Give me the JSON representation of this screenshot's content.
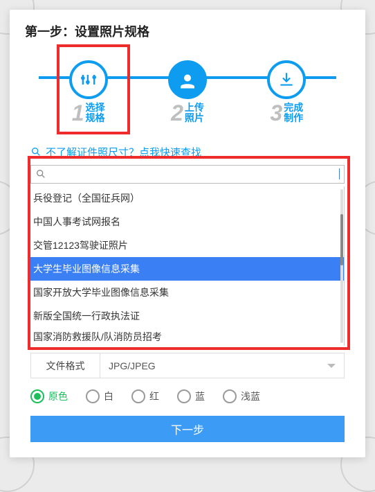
{
  "title": "第一步：设置照片规格",
  "steps": [
    {
      "num": "1",
      "line1": "选择",
      "line2": "规格"
    },
    {
      "num": "2",
      "line1": "上传",
      "line2": "照片"
    },
    {
      "num": "3",
      "line1": "完成",
      "line2": "制作"
    }
  ],
  "search_hint": "不了解证件照尺寸？点我快速查找",
  "search_placeholder": "",
  "dropdown": [
    "兵役登记（全国征兵网）",
    "中国人事考试网报名",
    "交管12123驾驶证照片",
    "大学生毕业图像信息采集",
    "国家开放大学毕业图像信息采集",
    "新版全国统一行政执法证",
    "国家消防救援队/队消防员招考"
  ],
  "selected_index": 3,
  "format": {
    "label": "文件格式",
    "value": "JPG/JPEG"
  },
  "colors": [
    {
      "label": "原色",
      "selected": true
    },
    {
      "label": "白",
      "selected": false
    },
    {
      "label": "红",
      "selected": false
    },
    {
      "label": "蓝",
      "selected": false
    },
    {
      "label": "浅蓝",
      "selected": false
    }
  ],
  "next_button": "下一步"
}
